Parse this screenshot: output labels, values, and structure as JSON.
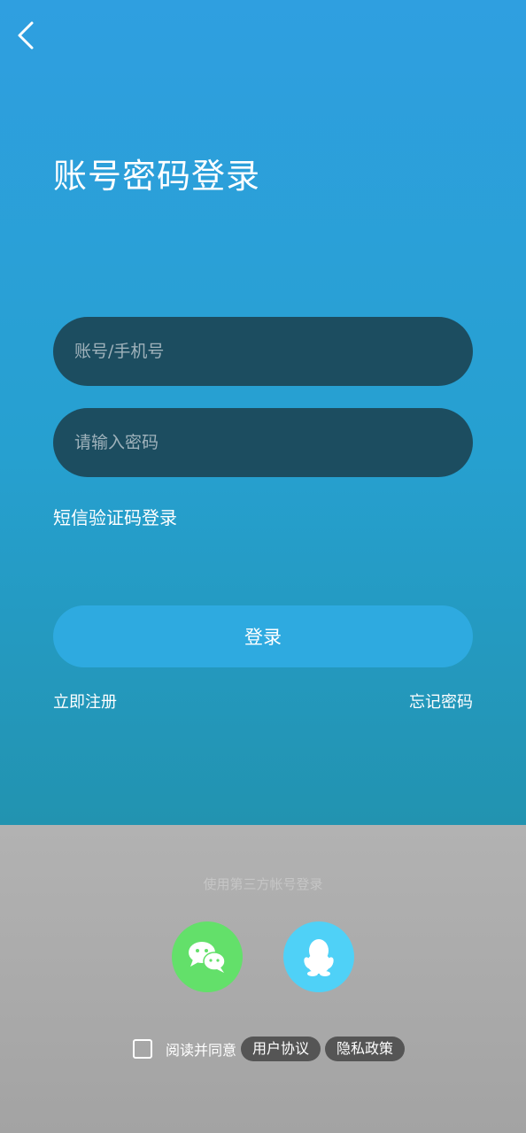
{
  "header": {
    "back_icon": "chevron-left-icon",
    "title": "账号密码登录"
  },
  "form": {
    "account_placeholder": "账号/手机号",
    "account_value": "",
    "password_placeholder": "请输入密码",
    "password_value": "",
    "sms_login_label": "短信验证码登录",
    "login_button_label": "登录",
    "register_label": "立即注册",
    "forgot_label": "忘记密码"
  },
  "third_party": {
    "label": "使用第三方帐号登录",
    "options": [
      {
        "icon": "wechat-icon",
        "color": "#63e06a"
      },
      {
        "icon": "qq-penguin-icon",
        "color": "#4fd1f7"
      }
    ]
  },
  "agreement": {
    "checked": false,
    "prefix": "阅读并同意",
    "user_agreement": "用户协议",
    "privacy_policy": "隐私政策"
  },
  "colors": {
    "accent": "#2eaae0",
    "field_bg": "#1c4d60"
  }
}
